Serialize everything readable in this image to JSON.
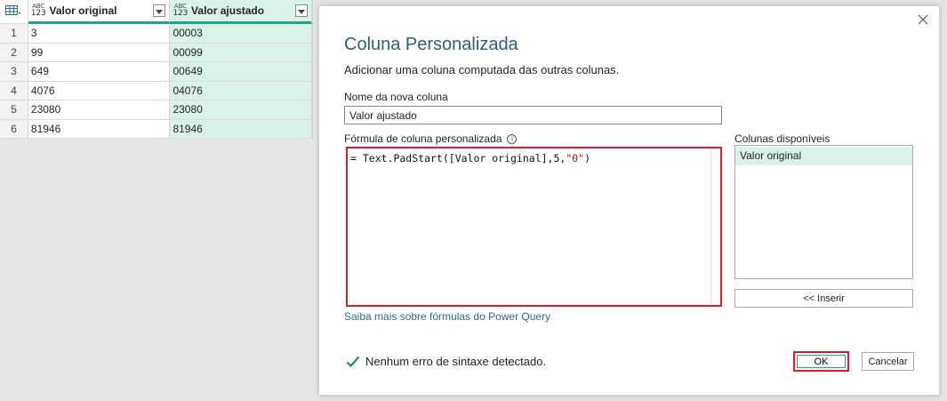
{
  "grid": {
    "corner_icon": "table-icon",
    "columns": [
      {
        "type_top": "ABC",
        "type_bottom": "123",
        "title": "Valor original"
      },
      {
        "type_top": "ABC",
        "type_bottom": "123",
        "title": "Valor ajustado"
      }
    ],
    "rows": [
      {
        "n": "1",
        "a": "3",
        "b": "00003"
      },
      {
        "n": "2",
        "a": "99",
        "b": "00099"
      },
      {
        "n": "3",
        "a": "649",
        "b": "00649"
      },
      {
        "n": "4",
        "a": "4076",
        "b": "04076"
      },
      {
        "n": "5",
        "a": "23080",
        "b": "23080"
      },
      {
        "n": "6",
        "a": "81946",
        "b": "81946"
      }
    ]
  },
  "dialog": {
    "title": "Coluna Personalizada",
    "subtitle": "Adicionar uma coluna computada das outras colunas.",
    "name_label": "Nome da nova coluna",
    "name_value": "Valor ajustado",
    "formula_label": "Fórmula de coluna personalizada",
    "formula_prefix": "= Text.PadStart([Valor original],5,",
    "formula_string": "\"0\"",
    "formula_suffix": ")",
    "learn_more": "Saiba mais sobre fórmulas do Power Query",
    "available_label": "Colunas disponíveis",
    "available_columns": [
      "Valor original"
    ],
    "insert_label": "<< Inserir",
    "status_text": "Nenhum erro de sintaxe detectado.",
    "ok_label": "OK",
    "cancel_label": "Cancelar"
  },
  "colors": {
    "accent_teal": "#1fa38c",
    "highlight_green": "#d9f1e6",
    "title_blue": "#2b5f73",
    "callout_red": "#d9202a",
    "check_green": "#1f8a5e"
  }
}
